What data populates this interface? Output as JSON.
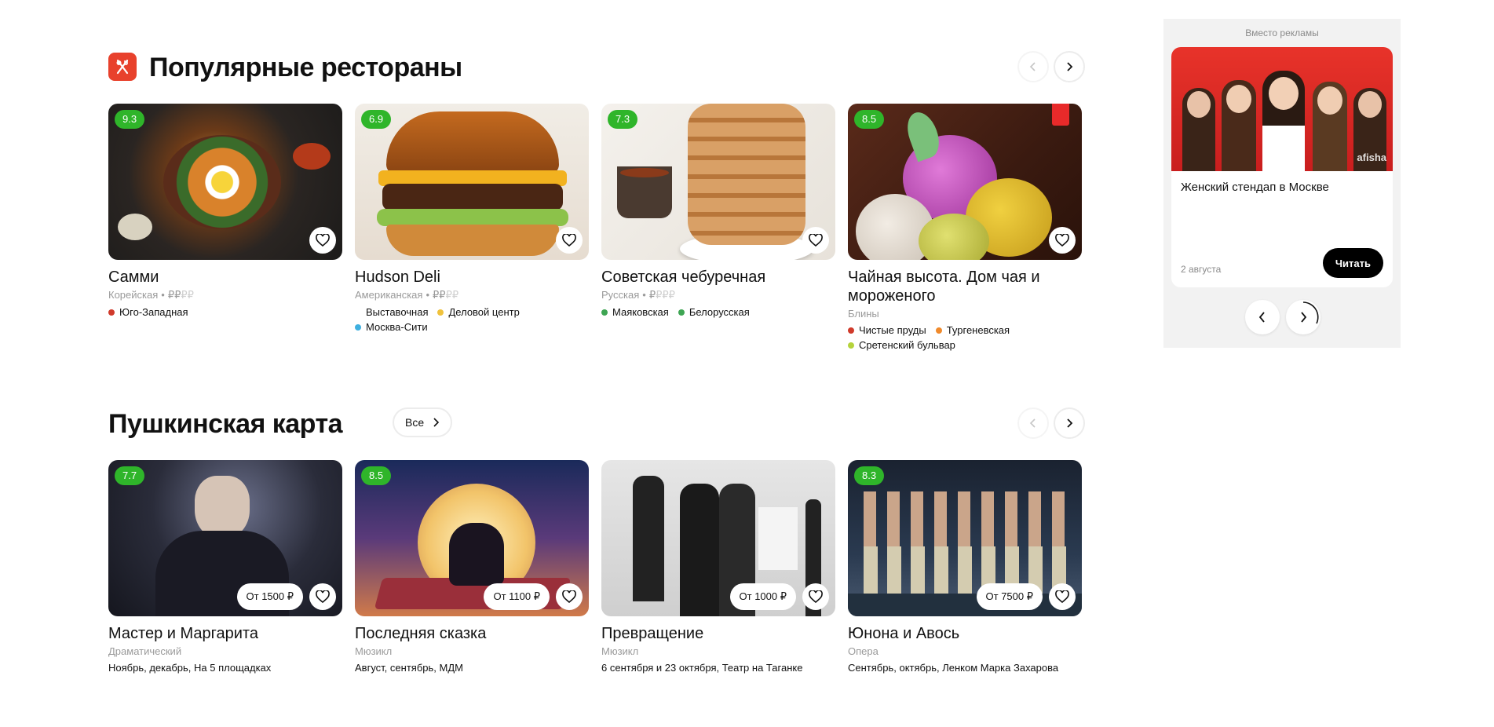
{
  "restaurants": {
    "title": "Популярные рестораны",
    "cards": [
      {
        "rating": "9.3",
        "title": "Самми",
        "cuisine": "Корейская",
        "price_on": "₽₽",
        "price_off": "₽₽",
        "metros": [
          {
            "name": "Юго-Западная",
            "color": "#d03a2b"
          }
        ]
      },
      {
        "rating": "6.9",
        "title": "Hudson Deli",
        "cuisine": "Американская",
        "price_on": "₽₽",
        "price_off": "₽₽",
        "metros": [
          {
            "name": "Выставочная",
            "color": "#ffffff"
          },
          {
            "name": "Деловой центр",
            "color": "#f0c23c"
          },
          {
            "name": "Москва-Сити",
            "color": "#3fb0e0"
          }
        ]
      },
      {
        "rating": "7.3",
        "title": "Советская чебуречная",
        "cuisine": "Русская",
        "price_on": "₽",
        "price_off": "₽₽₽",
        "metros": [
          {
            "name": "Маяковская",
            "color": "#3ea553"
          },
          {
            "name": "Белорусская",
            "color": "#3ea553"
          }
        ]
      },
      {
        "rating": "8.5",
        "title": "Чайная высота. Дом чая и мороженого",
        "cuisine": "Блины",
        "price_on": "",
        "price_off": "",
        "metros": [
          {
            "name": "Чистые пруды",
            "color": "#d03a2b"
          },
          {
            "name": "Тургеневская",
            "color": "#f08a2c"
          },
          {
            "name": "Сретенский бульвар",
            "color": "#b5d33c"
          }
        ]
      }
    ]
  },
  "pushkin": {
    "title": "Пушкинская карта",
    "all_label": "Все",
    "cards": [
      {
        "rating": "7.7",
        "title": "Мастер и Маргарита",
        "genre": "Драматический",
        "price": "От 1500 ₽",
        "desc": "Ноябрь, декабрь, На 5 площадках"
      },
      {
        "rating": "8.5",
        "title": "Последняя сказка",
        "genre": "Мюзикл",
        "price": "От 1100 ₽",
        "desc": "Август, сентябрь, МДМ"
      },
      {
        "rating": "",
        "title": "Превращение",
        "genre": "Мюзикл",
        "price": "От 1000 ₽",
        "desc": "6 сентября и 23 октября, Театр на Таганке"
      },
      {
        "rating": "8.3",
        "title": "Юнона и Авось",
        "genre": "Опера",
        "price": "От 7500 ₽",
        "desc": "Сентябрь, октябрь, Ленком Марка Захарова"
      }
    ]
  },
  "ad": {
    "label": "Вместо рекламы",
    "title": "Женский стендап в Москве",
    "date": "2 августа",
    "button": "Читать",
    "image_caption": "afisha"
  },
  "colors": {
    "rating_green": "#2fb52a",
    "accent_red": "#e8412c"
  }
}
